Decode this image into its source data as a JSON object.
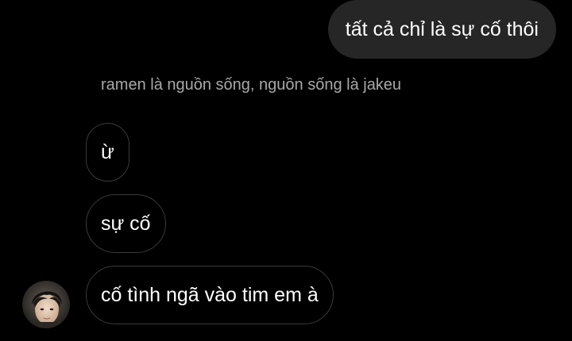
{
  "conversation": {
    "outgoing": [
      {
        "text": "tất cả chỉ là sự cố thôi"
      }
    ],
    "sender_label": "ramen là nguồn sống, nguồn sống là jakeu",
    "incoming": [
      {
        "text": "ừ"
      },
      {
        "text": "sự cố"
      },
      {
        "text": "cố tình ngã vào tim em à"
      }
    ],
    "avatar": {
      "icon": "profile-photo-avatar"
    }
  },
  "colors": {
    "background": "#000000",
    "outgoing_bubble": "#262626",
    "incoming_border": "#3a3a3a",
    "label_text": "#a8a8a8",
    "message_text": "#ffffff"
  }
}
